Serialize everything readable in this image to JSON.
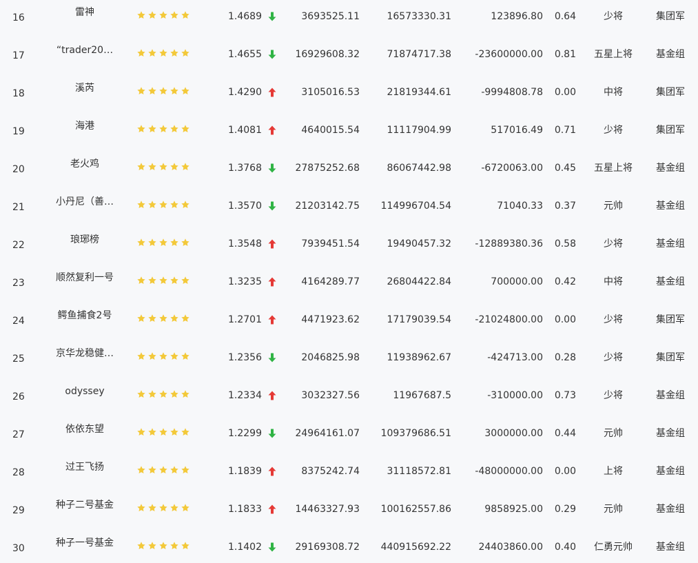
{
  "colors": {
    "background": "#f7f8fa",
    "text": "#333333",
    "star": "#f3c93a",
    "arrow_up": "#e53935",
    "arrow_down": "#2fb344"
  },
  "rows": [
    {
      "rank": "16",
      "name": "雷神",
      "stars": 5,
      "nav": "1.4689",
      "trend": "down",
      "v1": "3693525.11",
      "v2": "16573330.31",
      "v3": "123896.80",
      "ratio": "0.64",
      "level": "少将",
      "group": "集团军"
    },
    {
      "rank": "17",
      "name": "“trader20…",
      "stars": 5,
      "nav": "1.4655",
      "trend": "down",
      "v1": "16929608.32",
      "v2": "71874717.38",
      "v3": "-23600000.00",
      "ratio": "0.81",
      "level": "五星上将",
      "group": "基金组"
    },
    {
      "rank": "18",
      "name": "溪芮",
      "stars": 5,
      "nav": "1.4290",
      "trend": "up",
      "v1": "3105016.53",
      "v2": "21819344.61",
      "v3": "-9994808.78",
      "ratio": "0.00",
      "level": "中将",
      "group": "集团军"
    },
    {
      "rank": "19",
      "name": "海港",
      "stars": 5,
      "nav": "1.4081",
      "trend": "up",
      "v1": "4640015.54",
      "v2": "11117904.99",
      "v3": "517016.49",
      "ratio": "0.71",
      "level": "少将",
      "group": "集团军"
    },
    {
      "rank": "20",
      "name": "老火鸡",
      "stars": 5,
      "nav": "1.3768",
      "trend": "down",
      "v1": "27875252.68",
      "v2": "86067442.98",
      "v3": "-6720063.00",
      "ratio": "0.45",
      "level": "五星上将",
      "group": "基金组"
    },
    {
      "rank": "21",
      "name": "小丹尼（善…",
      "stars": 5,
      "nav": "1.3570",
      "trend": "down",
      "v1": "21203142.75",
      "v2": "114996704.54",
      "v3": "71040.33",
      "ratio": "0.37",
      "level": "元帅",
      "group": "基金组"
    },
    {
      "rank": "22",
      "name": "琅琊榜",
      "stars": 5,
      "nav": "1.3548",
      "trend": "up",
      "v1": "7939451.54",
      "v2": "19490457.32",
      "v3": "-12889380.36",
      "ratio": "0.58",
      "level": "少将",
      "group": "基金组"
    },
    {
      "rank": "23",
      "name": "顺然复利一号",
      "stars": 5,
      "nav": "1.3235",
      "trend": "up",
      "v1": "4164289.77",
      "v2": "26804422.84",
      "v3": "700000.00",
      "ratio": "0.42",
      "level": "中将",
      "group": "基金组"
    },
    {
      "rank": "24",
      "name": "鳄鱼捕食2号",
      "stars": 5,
      "nav": "1.2701",
      "trend": "up",
      "v1": "4471923.62",
      "v2": "17179039.54",
      "v3": "-21024800.00",
      "ratio": "0.00",
      "level": "少将",
      "group": "集团军"
    },
    {
      "rank": "25",
      "name": "京华龙稳健…",
      "stars": 5,
      "nav": "1.2356",
      "trend": "down",
      "v1": "2046825.98",
      "v2": "11938962.67",
      "v3": "-424713.00",
      "ratio": "0.28",
      "level": "少将",
      "group": "集团军"
    },
    {
      "rank": "26",
      "name": "odyssey",
      "stars": 5,
      "nav": "1.2334",
      "trend": "up",
      "v1": "3032327.56",
      "v2": "11967687.5",
      "v3": "-310000.00",
      "ratio": "0.73",
      "level": "少将",
      "group": "基金组"
    },
    {
      "rank": "27",
      "name": "依依东望",
      "stars": 5,
      "nav": "1.2299",
      "trend": "down",
      "v1": "24964161.07",
      "v2": "109379686.51",
      "v3": "3000000.00",
      "ratio": "0.44",
      "level": "元帅",
      "group": "基金组"
    },
    {
      "rank": "28",
      "name": "过王飞扬",
      "stars": 5,
      "nav": "1.1839",
      "trend": "up",
      "v1": "8375242.74",
      "v2": "31118572.81",
      "v3": "-48000000.00",
      "ratio": "0.00",
      "level": "上将",
      "group": "基金组"
    },
    {
      "rank": "29",
      "name": "种子二号基金",
      "stars": 5,
      "nav": "1.1833",
      "trend": "up",
      "v1": "14463327.93",
      "v2": "100162557.86",
      "v3": "9858925.00",
      "ratio": "0.29",
      "level": "元帅",
      "group": "基金组"
    },
    {
      "rank": "30",
      "name": "种子一号基金",
      "stars": 5,
      "nav": "1.1402",
      "trend": "down",
      "v1": "29169308.72",
      "v2": "440915692.22",
      "v3": "24403860.00",
      "ratio": "0.40",
      "level": "仁勇元帅",
      "group": "基金组"
    }
  ]
}
